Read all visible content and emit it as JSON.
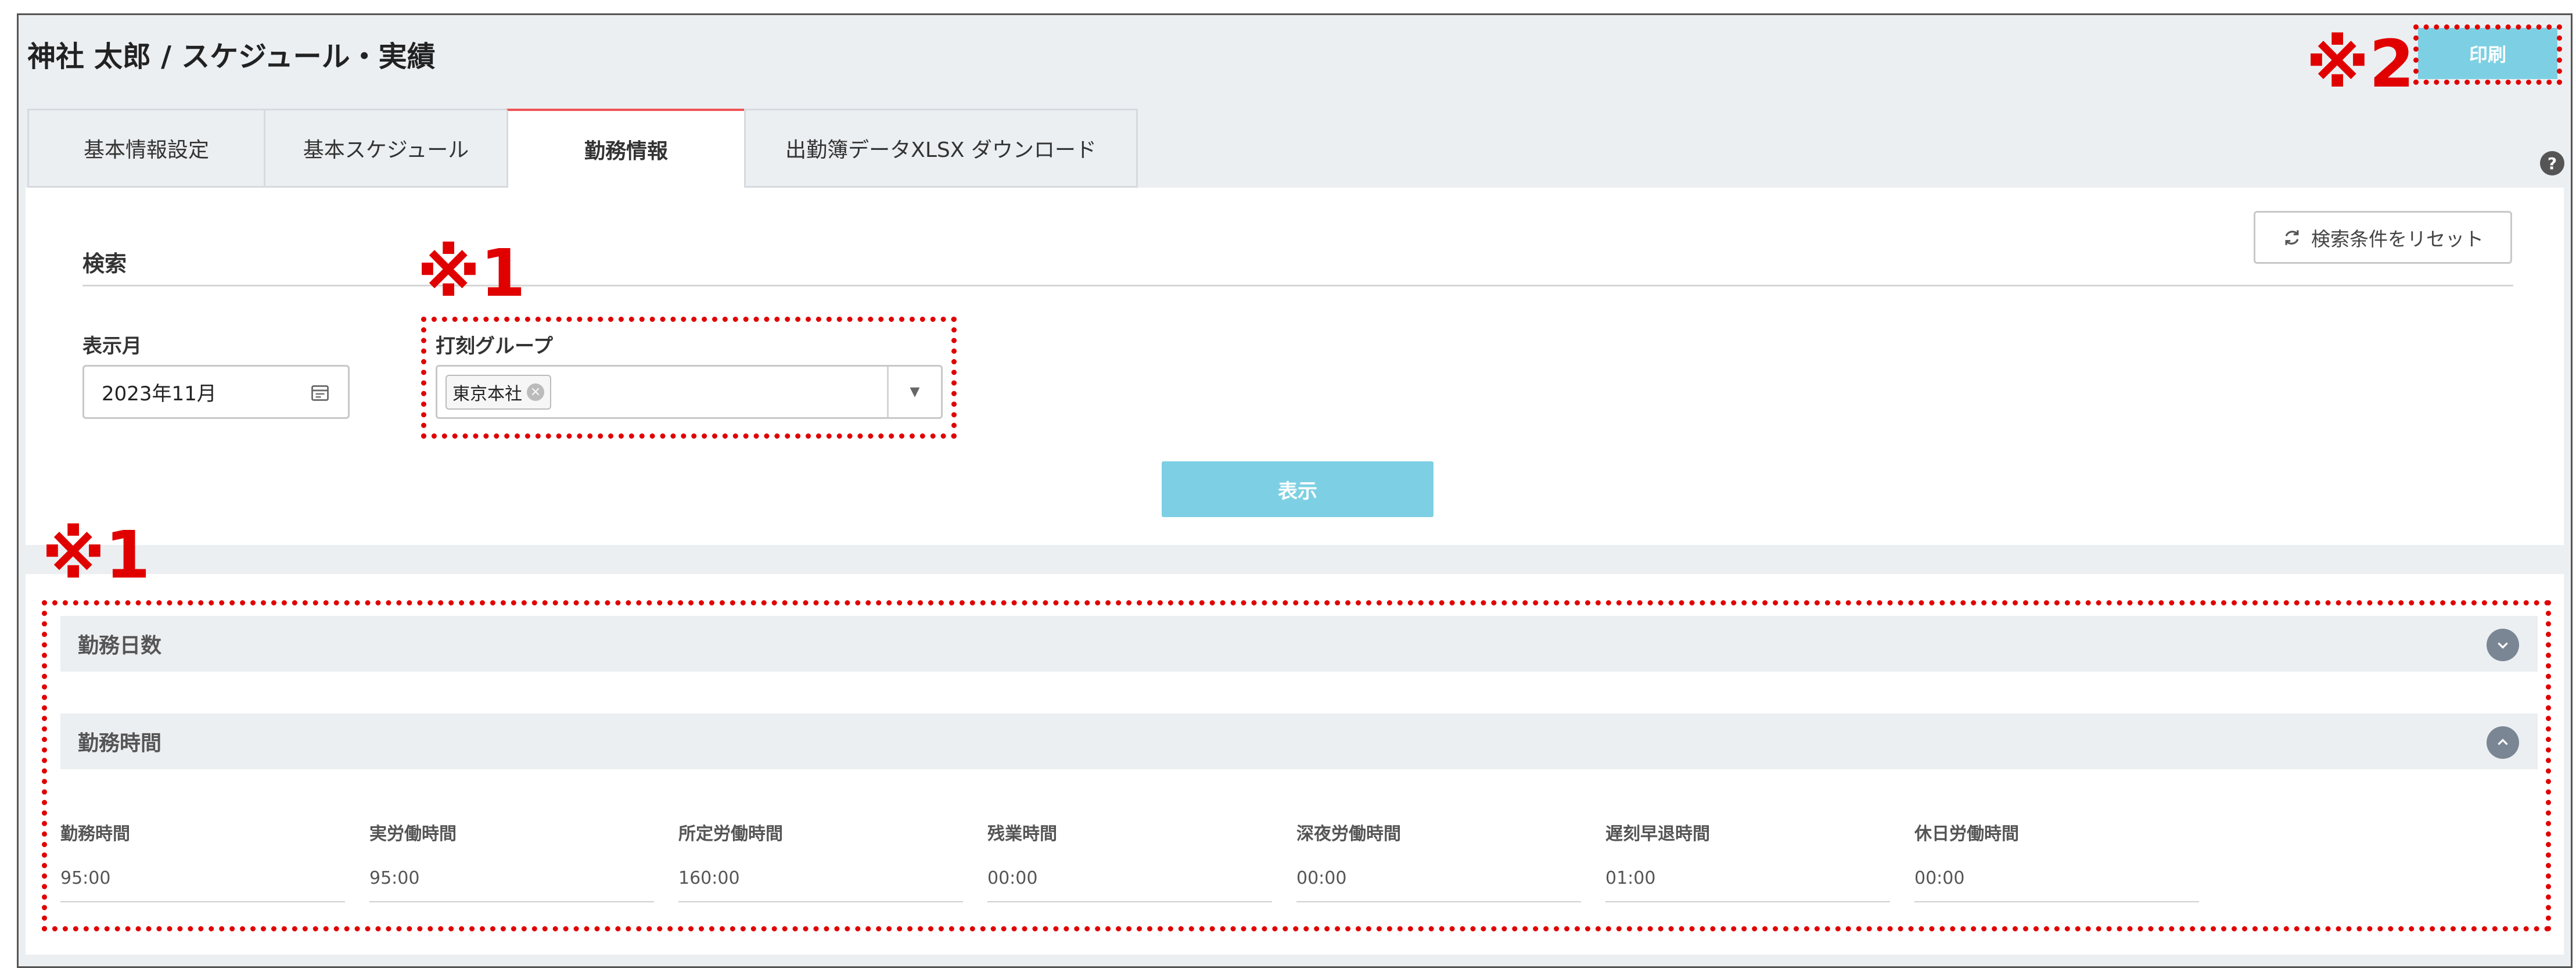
{
  "page": {
    "title": "神社 太郎 / スケジュール・実績"
  },
  "header": {
    "print_label": "印刷",
    "help_label": "?"
  },
  "tabs": [
    {
      "label": "基本情報設定",
      "active": false
    },
    {
      "label": "基本スケジュール",
      "active": false
    },
    {
      "label": "勤務情報",
      "active": true
    },
    {
      "label": "出勤簿データXLSX ダウンロード",
      "active": false
    }
  ],
  "search": {
    "heading": "検索",
    "reset_label": "検索条件をリセット",
    "month_label": "表示月",
    "month_value": "2023年11月",
    "group_label": "打刻グループ",
    "group_chip": "東京本社",
    "show_label": "表示"
  },
  "sections": {
    "days": {
      "title": "勤務日数",
      "expanded": false
    },
    "hours": {
      "title": "勤務時間",
      "expanded": true
    }
  },
  "metrics": [
    {
      "label": "勤務時間",
      "value": "95:00"
    },
    {
      "label": "実労働時間",
      "value": "95:00"
    },
    {
      "label": "所定労働時間",
      "value": "160:00"
    },
    {
      "label": "残業時間",
      "value": "00:00"
    },
    {
      "label": "深夜労働時間",
      "value": "00:00"
    },
    {
      "label": "遅刻早退時間",
      "value": "01:00"
    },
    {
      "label": "休日労働時間",
      "value": "00:00"
    }
  ],
  "annotations": {
    "mark1": "※1",
    "mark2": "※2"
  },
  "colors": {
    "accent": "#7dd0e3",
    "annotation": "#e00000",
    "active_tab": "#e55555"
  }
}
